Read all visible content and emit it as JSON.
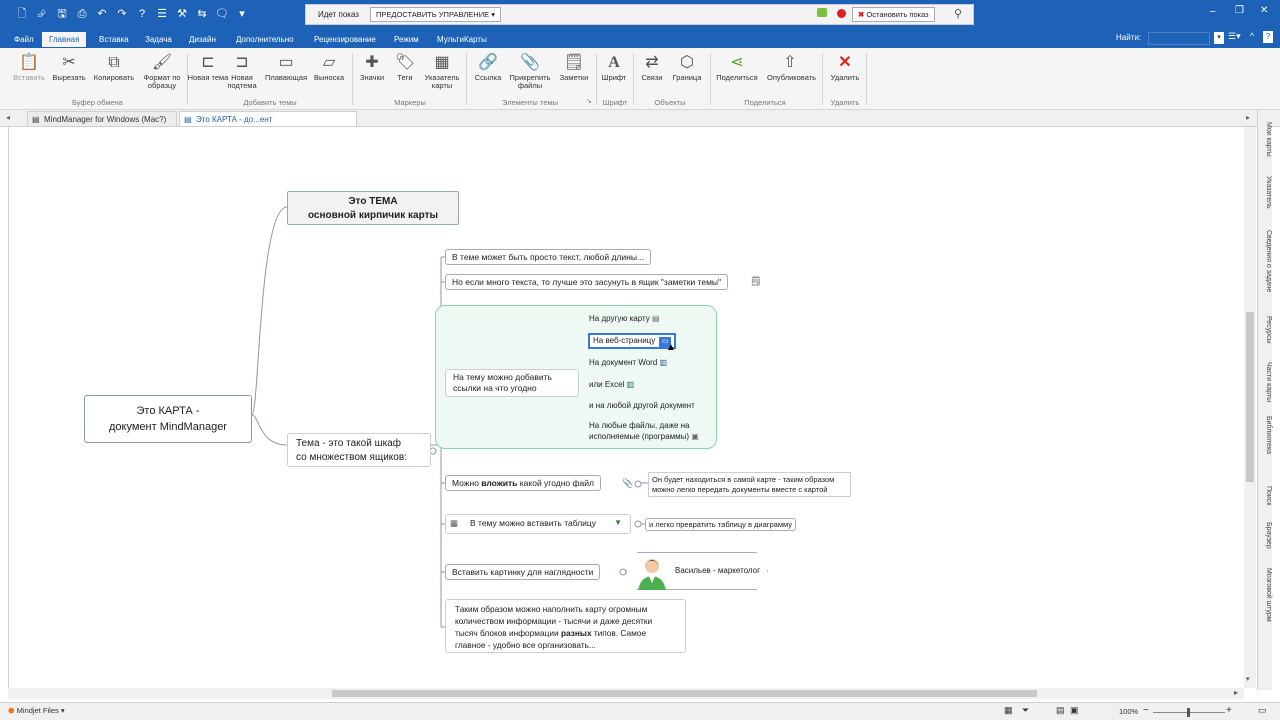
{
  "titlebar": {
    "show_status": "Идет показ",
    "control_button": "ПРЕДОСТАВИТЬ УПРАВЛЕНИЕ",
    "stop_button": "Остановить показ"
  },
  "ribbon_tabs": [
    "Файл",
    "Главная",
    "Вставка",
    "Задача",
    "Дизайн",
    "Дополнительно",
    "Рецензирование",
    "Режим",
    "МультиКарты"
  ],
  "active_tab": "Главная",
  "search_label": "Найти:",
  "ribbon": {
    "clipboard": {
      "paste": "Вставить",
      "cut": "Вырезать",
      "copy": "Копировать",
      "format": "Формат по образцу",
      "group": "Буфер обмена"
    },
    "add_topics": {
      "new_topic": "Новая тема",
      "new_subtopic": "Новая подтема",
      "floating": "Плавающая",
      "callout": "Выноска",
      "group": "Добавить темы"
    },
    "markers": {
      "icons": "Значки",
      "tags": "Теги",
      "index": "Указатель карты",
      "group": "Маркеры"
    },
    "topic_elements": {
      "link": "Ссылка",
      "attach": "Прикрепить файлы",
      "notes": "Заметки",
      "group": "Элементы темы"
    },
    "font": {
      "font": "Шрифт",
      "group": "Шрифт"
    },
    "objects": {
      "relationships": "Связи",
      "boundary": "Граница",
      "group": "Объекты"
    },
    "share": {
      "share": "Поделиться",
      "publish": "Опубликовать",
      "group": "Поделиться"
    },
    "delete": {
      "delete": "Удалить",
      "group": "Удалить"
    }
  },
  "doc_tabs": [
    {
      "label": "MindManager for Windows (Mac?)"
    },
    {
      "label": "Это КАРТА - до...ент MindManager"
    }
  ],
  "map": {
    "central": [
      "Это КАРТА  -",
      "документ MindManager"
    ],
    "topic1": [
      "Это ТЕМА",
      "основной кирпичик карты"
    ],
    "topic2": [
      "Тема  - это такой шкаф",
      "со множеством ящиков:"
    ],
    "sub1": "В теме может быть просто текст, любой длины...",
    "sub2": "Но если много текста, то лучше это засунуть в ящик \"заметки темы\"",
    "sub3": [
      "На тему можно добавить",
      "ссылки на что угодно"
    ],
    "links": {
      "l1": "На другую карту",
      "l2": "На веб-страницу",
      "l3": "На документ Word",
      "l4": "или Excel",
      "l5": "и на любой другой документ",
      "l6": [
        "На любые файлы, даже на",
        "исполняемые (программы)"
      ]
    },
    "sub4_pre": "Можно ",
    "sub4_bold": "вложить",
    "sub4_post": " какой угодно файл",
    "sub4_note": [
      "Он будет находиться в самой карте - таким образом",
      "можно легко передать документы вместе с картой"
    ],
    "sub5": "В тему можно вставить таблицу",
    "sub5_note": "и легко превратить таблицу в диаграмму",
    "sub6": "Вставить картинку для наглядности",
    "person": "Васильев - маркетолог",
    "sub7": {
      "line1": "Таким образом можно наполнить карту огромным",
      "line2": "количеством информации - тысячи и даже десятки",
      "line3_pre": "тысяч блоков информации ",
      "line3_bold": "разных",
      "line3_post": " типов. Самое",
      "line4": "главное - удобно все организовать..."
    }
  },
  "sidebar": [
    "Мои карты",
    "Указатель",
    "Сведения о задаче",
    "Ресурсы",
    "Части карты",
    "Библиотека",
    "Поиск",
    "Браузер",
    "Мозговой штурм"
  ],
  "status": {
    "left": "Mindjet Files",
    "zoom": "100%"
  }
}
